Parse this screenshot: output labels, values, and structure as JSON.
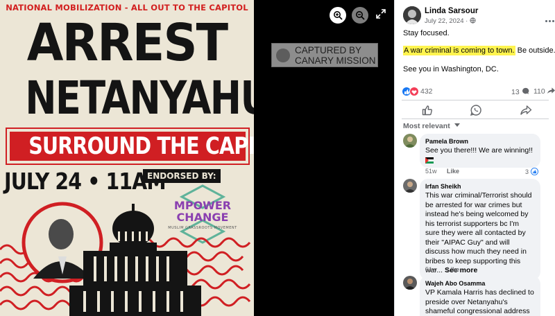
{
  "poster": {
    "topline": "NATIONAL MOBILIZATION - ALL OUT TO THE CAPITOL",
    "headline_1": "ARREST",
    "headline_2": "NETANYAHU!",
    "banner": "SURROUND THE CAPITOL",
    "date_time": "JULY 24 • 11AM",
    "endorsed_label": "ENDORSED BY:",
    "endorser_name": "MPOWER CHANGE",
    "endorser_tagline": "MUSLIM GRASSROOTS MOVEMENT",
    "colors": {
      "red": "#d01f23",
      "paper": "#ece6d6",
      "ink": "#141414",
      "endorser": "#8a3fb0"
    }
  },
  "watermark": {
    "line_1": "CAPTURED BY",
    "line_2": "CANARY MISSION"
  },
  "viewer": {
    "zoom_in_icon": "zoom-in-icon",
    "zoom_out_icon": "zoom-out-icon",
    "expand_icon": "expand-icon"
  },
  "post": {
    "author": "Linda Sarsour",
    "date": "July 22, 2024 · ",
    "privacy_icon": "globe-icon",
    "lines": [
      "Stay focused.",
      "A war criminal is coming to town.",
      " Be outside.",
      "See you in Washington, DC."
    ],
    "reaction_count": "432",
    "comment_count": "13",
    "share_count": "110",
    "sort_label": "Most relevant"
  },
  "comments": [
    {
      "author": "Pamela Brown",
      "text": "See you there!!! We are winning!!",
      "age": "51w",
      "like": "Like",
      "reactions": "3"
    },
    {
      "author": "Irfan Sheikh",
      "text": "This war criminal/Terrorist should be arrested for war crimes but instead he's being welcomed by his terrorist supporters bc I'm sure they were all contacted by their \"AIPAC Guy\" and will discuss how much they need in bribes to keep supporting this war...",
      "see_more": "See more",
      "age": "51w",
      "like": "Like"
    },
    {
      "author": "Wajeh Abo Osamma",
      "text": "VP Kamala Harris has declined to preside over Netanyahu's shameful congressional address on"
    }
  ]
}
